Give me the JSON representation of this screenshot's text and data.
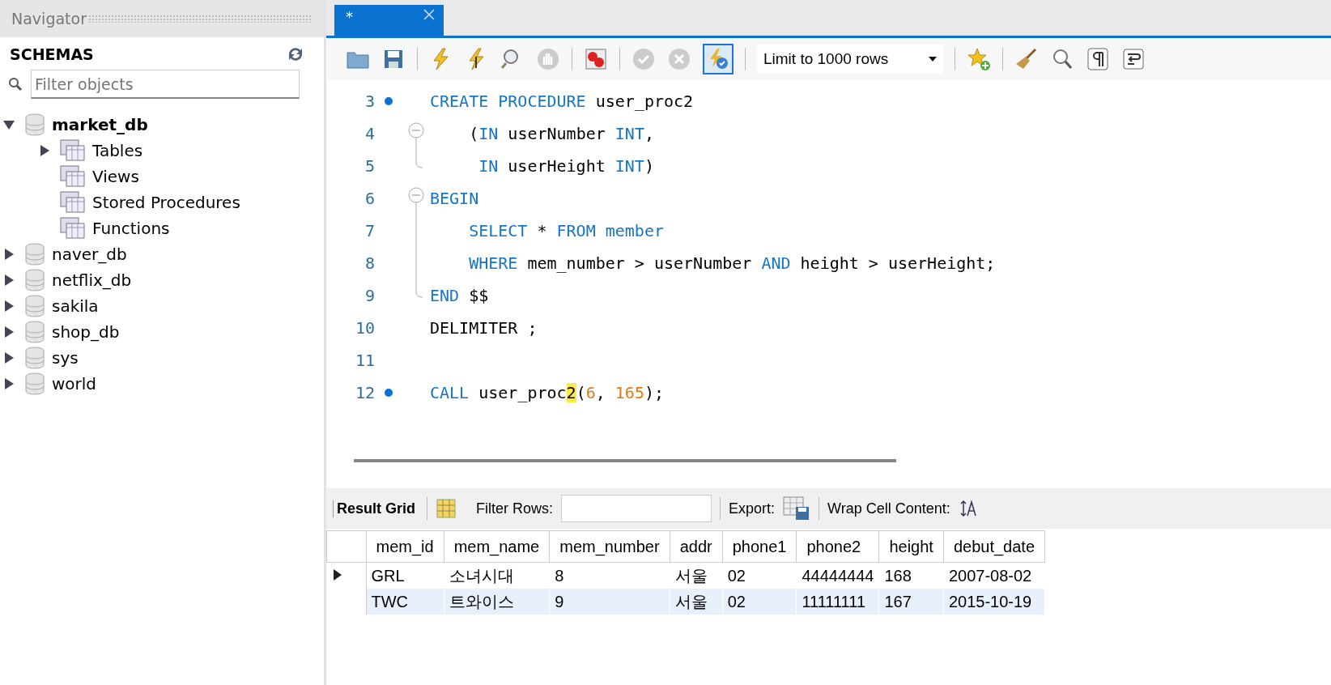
{
  "navigator": {
    "title": "Navigator",
    "section": "SCHEMAS",
    "filter": {
      "placeholder": "Filter objects"
    },
    "schemas": [
      {
        "name": "market_db",
        "expanded": true,
        "bold": true,
        "children": [
          {
            "name": "Tables",
            "expandable": true
          },
          {
            "name": "Views",
            "expandable": false
          },
          {
            "name": "Stored Procedures",
            "expandable": false
          },
          {
            "name": "Functions",
            "expandable": false
          }
        ]
      },
      {
        "name": "naver_db",
        "expanded": false,
        "bold": false
      },
      {
        "name": "netflix_db",
        "expanded": false,
        "bold": false
      },
      {
        "name": "sakila",
        "expanded": false,
        "bold": false
      },
      {
        "name": "shop_db",
        "expanded": false,
        "bold": false
      },
      {
        "name": "sys",
        "expanded": false,
        "bold": false
      },
      {
        "name": "world",
        "expanded": false,
        "bold": false
      }
    ]
  },
  "editor": {
    "tab": {
      "title": "*",
      "selected": true
    },
    "toolbar": {
      "limit": "Limit to 1000 rows",
      "autocommit_pressed": true
    },
    "lines": [
      {
        "number": "3",
        "statement": true,
        "kind": "plain",
        "indented": false,
        "tokens": [
          {
            "kind": "kw",
            "text": "CREATE PROCEDURE"
          },
          {
            "kind": "plain",
            "text": " user_proc2"
          }
        ]
      },
      {
        "number": "4",
        "statement": false,
        "kind": "fold-start",
        "indented": true,
        "tokens": [
          {
            "kind": "plain",
            "text": "("
          },
          {
            "kind": "kw",
            "text": "IN"
          },
          {
            "kind": "plain",
            "text": " userNumber "
          },
          {
            "kind": "kw",
            "text": "INT"
          },
          {
            "kind": "plain",
            "text": ","
          }
        ]
      },
      {
        "number": "5",
        "statement": false,
        "kind": "fold-end",
        "indented": true,
        "tokens": [
          {
            "kind": "kw",
            "text": " IN"
          },
          {
            "kind": "plain",
            "text": " userHeight "
          },
          {
            "kind": "kw",
            "text": "INT"
          },
          {
            "kind": "plain",
            "text": ")"
          }
        ]
      },
      {
        "number": "6",
        "statement": false,
        "kind": "fold-start",
        "indented": false,
        "tokens": [
          {
            "kind": "kw",
            "text": "BEGIN"
          }
        ]
      },
      {
        "number": "7",
        "statement": false,
        "kind": "fold-body",
        "indented": true,
        "tokens": [
          {
            "kind": "kw",
            "text": "SELECT"
          },
          {
            "kind": "plain",
            "text": " * "
          },
          {
            "kind": "kw",
            "text": "FROM member"
          }
        ]
      },
      {
        "number": "8",
        "statement": false,
        "kind": "fold-body",
        "indented": true,
        "tokens": [
          {
            "kind": "kw",
            "text": "WHERE"
          },
          {
            "kind": "plain",
            "text": " mem_number > userNumber "
          },
          {
            "kind": "kw",
            "text": "AND"
          },
          {
            "kind": "plain",
            "text": " height > userHeight;"
          }
        ]
      },
      {
        "number": "9",
        "statement": false,
        "kind": "fold-end",
        "indented": false,
        "tokens": [
          {
            "kind": "kw",
            "text": "END"
          },
          {
            "kind": "plain",
            "text": " $$"
          }
        ]
      },
      {
        "number": "10",
        "statement": false,
        "kind": "plain",
        "indented": false,
        "tokens": [
          {
            "kind": "plain",
            "text": "DELIMITER ;"
          }
        ]
      },
      {
        "number": "11",
        "statement": false,
        "kind": "plain"
      },
      {
        "number": "12",
        "statement": true,
        "kind": "plain",
        "indented": false,
        "tokens": [
          {
            "kind": "kw",
            "text": "CALL"
          },
          {
            "kind": "plain",
            "text": " user_proc"
          },
          {
            "kind": "match",
            "text": "2"
          },
          {
            "kind": "plain",
            "text": "("
          },
          {
            "kind": "num",
            "text": "6"
          },
          {
            "kind": "plain",
            "text": ", "
          },
          {
            "kind": "num",
            "text": "165"
          },
          {
            "kind": "plain",
            "text": ");"
          }
        ]
      }
    ]
  },
  "result": {
    "toolbar": {
      "grid_tab": "Result Grid",
      "filter_label": "Filter Rows:",
      "export_label": "Export:",
      "wrap_label": "Wrap Cell Content:"
    },
    "columns": [
      "mem_id",
      "mem_name",
      "mem_number",
      "addr",
      "phone1",
      "phone2",
      "height",
      "debut_date"
    ],
    "rows": [
      {
        "current": true,
        "cells": [
          "GRL",
          "소녀시대",
          "8",
          "서울",
          "02",
          "44444444",
          "168",
          "2007-08-02"
        ]
      },
      {
        "current": false,
        "cells": [
          "TWC",
          "트와이스",
          "9",
          "서울",
          "02",
          "11111111",
          "167",
          "2015-10-19"
        ]
      }
    ]
  }
}
